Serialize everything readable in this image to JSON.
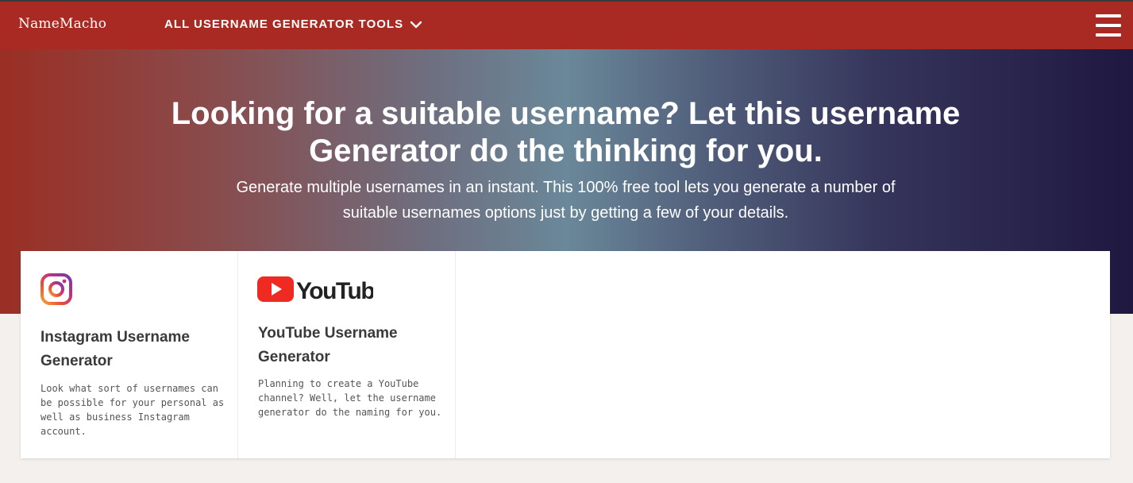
{
  "navbar": {
    "brand": "NameMacho",
    "tools_menu_label": "ALL USERNAME GENERATOR TOOLS",
    "menu_icon": "hamburger-menu-icon",
    "color": "#a92a22"
  },
  "hero": {
    "title_line1": "Looking for a suitable username? Let this username",
    "title_line2": "Generator do the thinking for you.",
    "subtitle_line1": "Generate multiple usernames in an instant. This 100% free tool lets you generate a number of",
    "subtitle_line2": "suitable usernames options just by getting a few of your details."
  },
  "cards": [
    {
      "icon": "instagram-icon",
      "title_line1": "Instagram Username",
      "title_line2": "Generator",
      "desc_lines": [
        "Look what sort of usernames can",
        "be possible for your personal as",
        "well as business Instagram",
        "account."
      ]
    },
    {
      "icon": "youtube-logo",
      "logo_text": "YouTube",
      "title_line1": "YouTube Username",
      "title_line2": "Generator",
      "desc_lines": [
        "Planning to create a YouTube",
        "channel? Well, let the username",
        "generator do the naming for you."
      ]
    }
  ]
}
